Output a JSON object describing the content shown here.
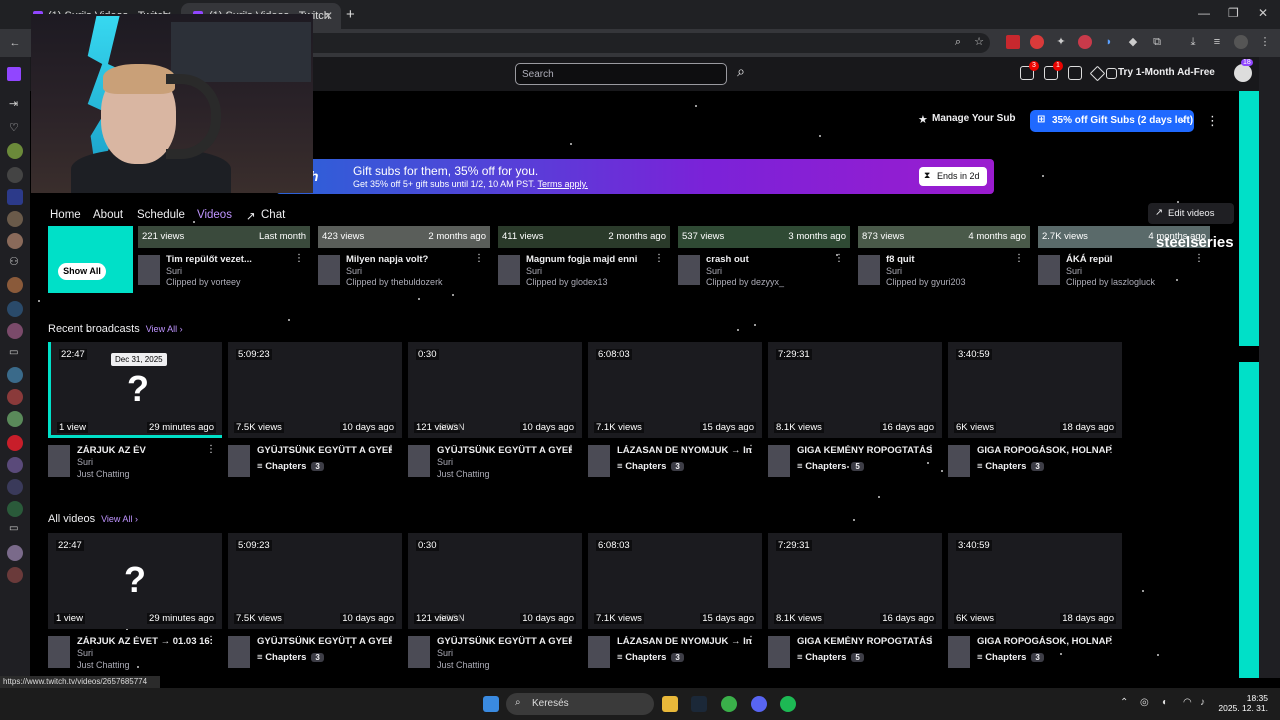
{
  "browser": {
    "tabs": [
      {
        "label": "(1) Suri's Videos - Twitch"
      },
      {
        "label": "(1) Suri's Videos - Twitch"
      }
    ],
    "status_url": "https://www.twitch.tv/videos/2657685774"
  },
  "header": {
    "search_placeholder": "Search",
    "notif_badge_1": "3",
    "notif_badge_2": "1",
    "prime_label": "Try 1-Month Ad-Free",
    "avatar_badge": "18"
  },
  "channel": {
    "manage_sub_label": "Manage Your Sub",
    "gift_btn_label": "35% off Gift Subs (2 days left)"
  },
  "promo": {
    "brand": "twitch",
    "headline": "Gift subs for them, 35% off for you.",
    "subline": "Get 35% off 5+ gift subs until 1/2, 10 AM PST.",
    "terms_link": "Terms apply.",
    "ends_label": "Ends in 2d"
  },
  "nav_tabs": [
    {
      "label": "Home"
    },
    {
      "label": "About"
    },
    {
      "label": "Schedule"
    },
    {
      "label": "Videos"
    },
    {
      "label": "Chat"
    }
  ],
  "edit_videos_label": "Edit videos",
  "clips": {
    "show_all_label": "Show All",
    "items": [
      {
        "views": "221 views",
        "age": "Last month",
        "title": "Tim repülőt vezet...",
        "channel": "Suri",
        "clipped_by": "Clipped by vorteey"
      },
      {
        "views": "423 views",
        "age": "2 months ago",
        "title": "Milyen napja volt?",
        "channel": "Suri",
        "clipped_by": "Clipped by thebuldozerk"
      },
      {
        "views": "411 views",
        "age": "2 months ago",
        "title": "Magnum fogja majd enni",
        "channel": "Suri",
        "clipped_by": "Clipped by glodex13"
      },
      {
        "views": "537 views",
        "age": "3 months ago",
        "title": "crash out",
        "channel": "Suri",
        "clipped_by": "Clipped by dezyyx_"
      },
      {
        "views": "873 views",
        "age": "4 months ago",
        "title": "f8 quit",
        "channel": "Suri",
        "clipped_by": "Clipped by gyuri203"
      },
      {
        "views": "2.7K views",
        "age": "4 months ago",
        "title": "ÁKÁ repül",
        "channel": "Suri",
        "clipped_by": "Clipped by laszlogluck"
      }
    ]
  },
  "recent": {
    "heading": "Recent broadcasts",
    "view_all": "View All",
    "tooltip": "Dec 31, 2025",
    "items": [
      {
        "duration": "22:47",
        "views": "1 view",
        "age": "29 minutes ago",
        "title": "ZÁRJUK AZ ÉV",
        "channel": "Suri",
        "category": "Just Chatting"
      },
      {
        "duration": "5:09:23",
        "views": "7.5K views",
        "age": "10 days ago",
        "title": "GYŰJTSÜNK EGYÜTT A GYER...",
        "chapters_label": "Chapters",
        "chapters": "3"
      },
      {
        "duration": "0:30",
        "views": "121 views",
        "age": "10 days ago",
        "title": "GYŰJTSÜNK EGYÜTT A GYER...",
        "channel": "Suri",
        "category": "Just Chatting",
        "overlay": "SOON"
      },
      {
        "duration": "6:08:03",
        "views": "7.1K views",
        "age": "15 days ago",
        "title": "LÁZASAN DE NYOMJUK → In...",
        "chapters_label": "Chapters",
        "chapters": "3"
      },
      {
        "duration": "7:29:31",
        "views": "8.1K views",
        "age": "16 days ago",
        "title": "GIGA KEMÉNY ROPOGTATÁS...",
        "chapters_label": "Chapters",
        "chapters": "5"
      },
      {
        "duration": "3:40:59",
        "views": "6K views",
        "age": "18 days ago",
        "title": "GIGA ROPOGÁSOK, HOLNAP K...",
        "chapters_label": "Chapters",
        "chapters": "3"
      }
    ]
  },
  "all": {
    "heading": "All videos",
    "view_all": "View All",
    "items": [
      {
        "duration": "22:47",
        "views": "1 view",
        "age": "29 minutes ago",
        "title": "ZÁRJUK AZ ÉVET → 01.03 16:...",
        "channel": "Suri",
        "category": "Just Chatting"
      },
      {
        "duration": "5:09:23",
        "views": "7.5K views",
        "age": "10 days ago",
        "title": "GYŰJTSÜNK EGYÜTT A GYER...",
        "chapters_label": "Chapters",
        "chapters": "3"
      },
      {
        "duration": "0:30",
        "views": "121 views",
        "age": "10 days ago",
        "title": "GYŰJTSÜNK EGYÜTT A GYER...",
        "channel": "Suri",
        "category": "Just Chatting",
        "overlay": "SOON"
      },
      {
        "duration": "6:08:03",
        "views": "7.1K views",
        "age": "15 days ago",
        "title": "LÁZASAN DE NYOMJUK → In...",
        "chapters_label": "Chapters",
        "chapters": "3"
      },
      {
        "duration": "7:29:31",
        "views": "8.1K views",
        "age": "16 days ago",
        "title": "GIGA KEMÉNY ROPOGTATÁS...",
        "chapters_label": "Chapters",
        "chapters": "5"
      },
      {
        "duration": "3:40:59",
        "views": "6K views",
        "age": "18 days ago",
        "title": "GIGA ROPOGÁSOK, HOLNAP K...",
        "chapters_label": "Chapters",
        "chapters": "3"
      }
    ]
  },
  "overlay_brand": "steelseries",
  "taskbar": {
    "search_label": "Keresés",
    "time": "18:35",
    "date": "2025. 12. 31."
  },
  "colors": {
    "accent": "#00e0c8",
    "twitch_purple": "#9146ff",
    "gift_blue": "#1f69ff"
  }
}
